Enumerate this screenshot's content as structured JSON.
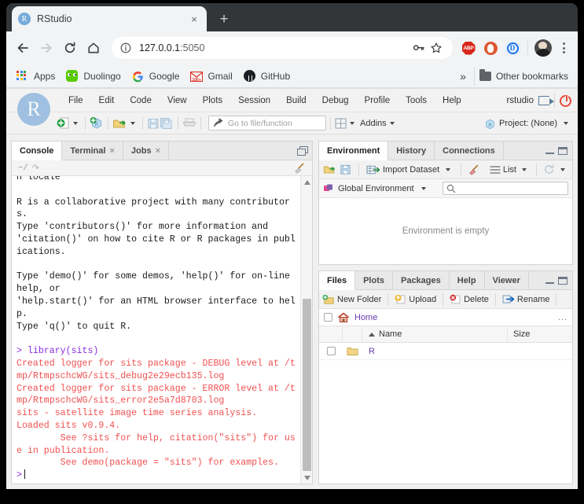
{
  "browser": {
    "tab": {
      "title": "RStudio",
      "favicon": "rstudio-favicon",
      "close_label": "×"
    },
    "new_tab_label": "+",
    "nav": {
      "back_icon": "back-arrow-icon",
      "forward_icon": "forward-arrow-icon",
      "reload_icon": "reload-icon",
      "home_icon": "home-icon"
    },
    "omnibox": {
      "host": "127.0.0.1",
      "port": ":5050",
      "info_icon": "site-info-icon",
      "key_icon": "password-key-icon",
      "star_icon": "bookmark-star-icon"
    },
    "extensions": [
      {
        "name": "adblock-plus-extension",
        "label": "ABP"
      },
      {
        "name": "duckduckgo-extension",
        "label": ""
      },
      {
        "name": "disconnect-extension",
        "label": "D"
      }
    ],
    "profile": {
      "name": "avatar"
    },
    "menu_icon": "three-dot-menu-icon",
    "bookmarks": [
      {
        "label": "Apps",
        "icon": "apps-grid-icon"
      },
      {
        "label": "Duolingo",
        "icon": "duolingo-icon"
      },
      {
        "label": "Google",
        "icon": "google-g-icon"
      },
      {
        "label": "Gmail",
        "icon": "gmail-envelope-icon"
      },
      {
        "label": "GitHub",
        "icon": "github-octocat-icon"
      }
    ],
    "bookmarks_overflow": "»",
    "other_bookmarks": "Other bookmarks"
  },
  "rstudio": {
    "logo_letter": "R",
    "menu": [
      "File",
      "Edit",
      "Code",
      "View",
      "Plots",
      "Session",
      "Build",
      "Debug",
      "Profile",
      "Tools",
      "Help"
    ],
    "user": "rstudio",
    "logout_icon": "logout-icon",
    "power_icon": "power-quit-icon",
    "toolbar": {
      "new_file_icon": "new-file-icon",
      "new_project_icon": "new-project-icon",
      "open_file_icon": "open-folder-icon",
      "save_icon": "save-icon",
      "save_all_icon": "save-all-icon",
      "print_icon": "print-icon",
      "goto_placeholder": "Go to file/function",
      "goto_icon": "goto-arrow-icon",
      "workspace_panes_icon": "pane-layout-icon",
      "addins_label": "Addins",
      "project_label": "Project: (None)",
      "project_icon": "project-cube-icon"
    },
    "console_pane": {
      "tabs": [
        {
          "label": "Console",
          "active": true,
          "closable": false
        },
        {
          "label": "Terminal",
          "active": false,
          "closable": true
        },
        {
          "label": "Jobs",
          "active": false,
          "closable": true
        }
      ],
      "stack_icon": "pane-stack-icon",
      "path": "~/",
      "path_arrow_icon": "open-in-new-window-icon",
      "broom_icon": "clear-console-broom-icon",
      "output_lines": [
        {
          "text": "n locale",
          "style": "out"
        },
        {
          "text": "",
          "style": "out"
        },
        {
          "text": "R is a collaborative project with many contributors.",
          "style": "out"
        },
        {
          "text": "Type 'contributors()' for more information and",
          "style": "out"
        },
        {
          "text": "'citation()' on how to cite R or R packages in publications.",
          "style": "out"
        },
        {
          "text": "",
          "style": "out"
        },
        {
          "text": "Type 'demo()' for some demos, 'help()' for on-line help, or",
          "style": "out"
        },
        {
          "text": "'help.start()' for an HTML browser interface to help.",
          "style": "out"
        },
        {
          "text": "Type 'q()' to quit R.",
          "style": "out"
        },
        {
          "text": "",
          "style": "out"
        },
        {
          "text": "> library(sits)",
          "style": "cmd"
        },
        {
          "text": "Created logger for sits package - DEBUG level at /tmp/RtmpschcWG/sits_debug2e29ecb135.log",
          "style": "err"
        },
        {
          "text": "Created logger for sits package - ERROR level at /tmp/RtmpschcWG/sits_error2e5a7d8703.log",
          "style": "err"
        },
        {
          "text": "sits - satellite image time series analysis.",
          "style": "err"
        },
        {
          "text": "Loaded sits v0.9.4.",
          "style": "err"
        },
        {
          "text": "        See ?sits for help, citation(\"sits\") for use in publication.",
          "style": "err"
        },
        {
          "text": "        See demo(package = \"sits\") for examples.",
          "style": "err"
        }
      ],
      "prompt": ">"
    },
    "environment_pane": {
      "tabs": [
        {
          "label": "Environment",
          "active": true
        },
        {
          "label": "History",
          "active": false
        },
        {
          "label": "Connections",
          "active": false
        }
      ],
      "toolbar": {
        "load_icon": "load-workspace-icon",
        "save_icon": "save-workspace-icon",
        "import_label": "Import Dataset",
        "import_icon": "import-dataset-icon",
        "broom_icon": "clear-objects-broom-icon",
        "list_label": "List",
        "list_icon": "list-view-icon",
        "refresh_icon": "refresh-icon"
      },
      "scope_label": "Global Environment",
      "scope_icon": "environment-cube-icon",
      "search_icon": "search-icon",
      "search_placeholder": "",
      "empty_message": "Environment is empty"
    },
    "files_pane": {
      "tabs": [
        {
          "label": "Files",
          "active": true
        },
        {
          "label": "Plots",
          "active": false
        },
        {
          "label": "Packages",
          "active": false
        },
        {
          "label": "Help",
          "active": false
        },
        {
          "label": "Viewer",
          "active": false
        }
      ],
      "toolbar": [
        {
          "label": "New Folder",
          "icon": "new-folder-icon"
        },
        {
          "label": "Upload",
          "icon": "upload-icon"
        },
        {
          "label": "Delete",
          "icon": "delete-icon"
        },
        {
          "label": "Rename",
          "icon": "rename-icon"
        }
      ],
      "breadcrumb": {
        "label": "Home",
        "icon": "home-folder-icon"
      },
      "more_icon": "more-options-icon",
      "columns": [
        "",
        "",
        "Name",
        "Size"
      ],
      "rows": [
        {
          "name": "R",
          "size": "",
          "icon": "folder-icon"
        }
      ]
    }
  }
}
